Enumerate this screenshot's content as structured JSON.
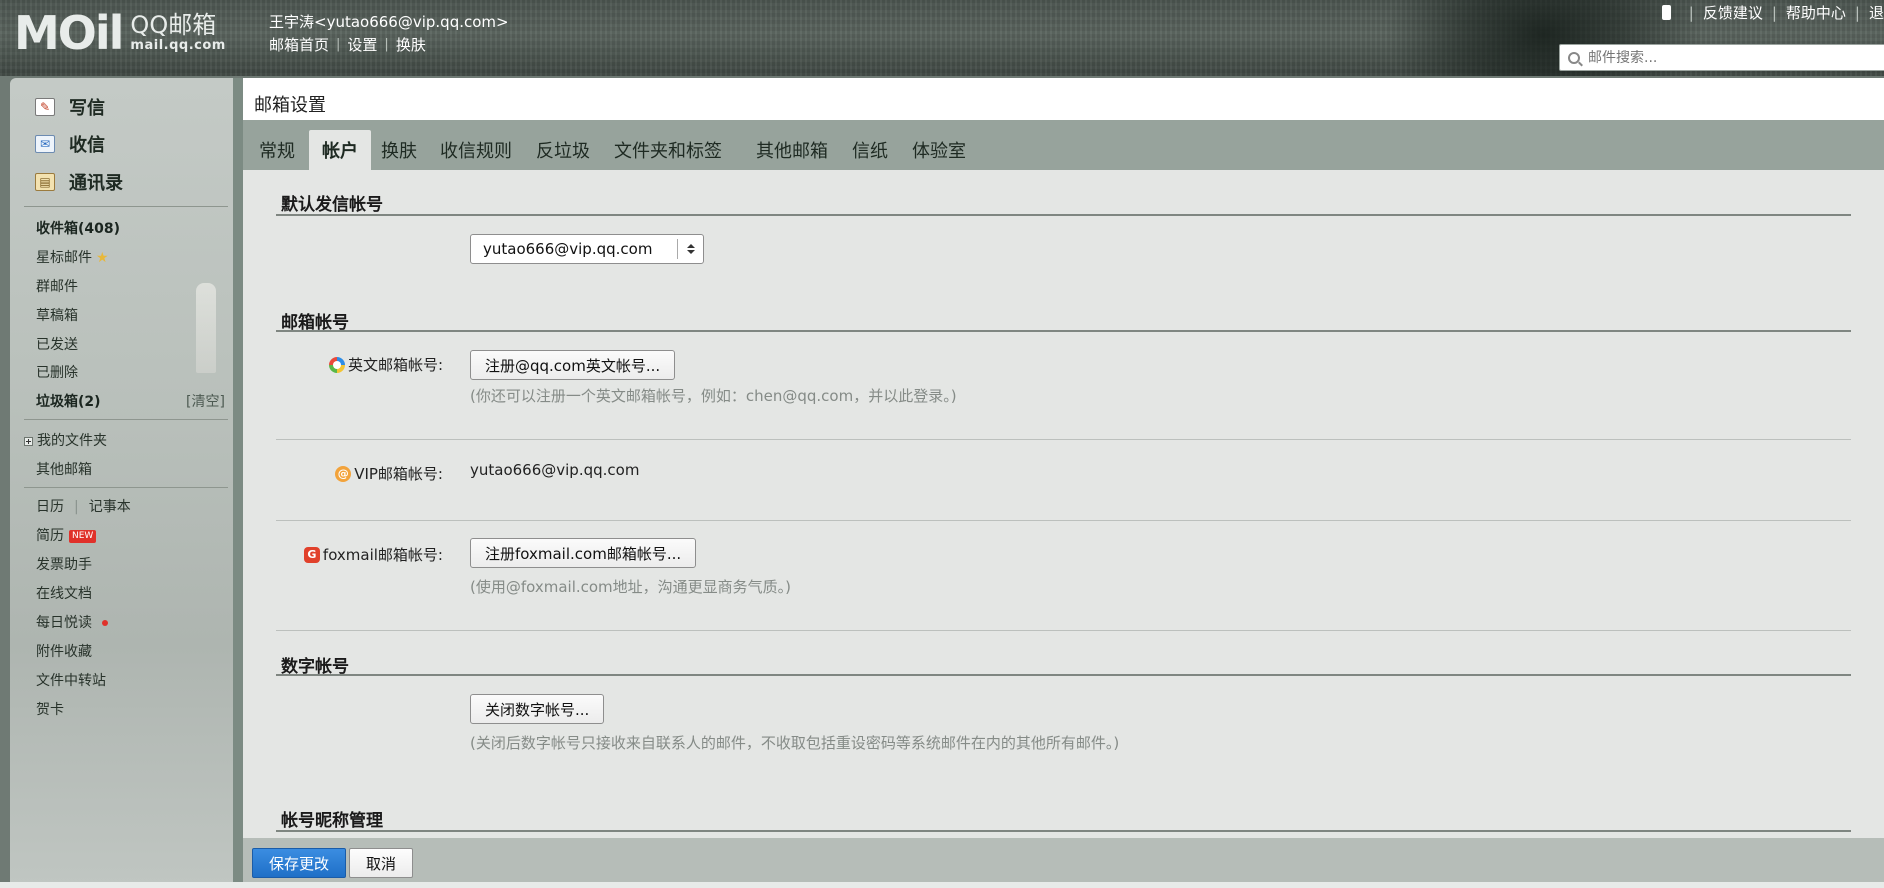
{
  "header": {
    "logo_mark": "MOil",
    "logo_title": "QQ邮箱",
    "logo_sub": "mail.qq.com",
    "user": "王宇涛<yutao666@vip.qq.com>",
    "links": [
      "邮箱首页",
      "设置",
      "换肤"
    ],
    "top_links": [
      "反馈建议",
      "帮助中心",
      "退"
    ],
    "search_placeholder": "邮件搜索..."
  },
  "sidebar": {
    "compose": "写信",
    "receive": "收信",
    "contacts": "通讯录",
    "folders": [
      {
        "label": "收件箱(408)"
      },
      {
        "label": "星标邮件"
      },
      {
        "label": "群邮件"
      },
      {
        "label": "草稿箱"
      },
      {
        "label": "已发送"
      },
      {
        "label": "已删除"
      },
      {
        "label": "垃圾箱(2)"
      }
    ],
    "clear": "[清空]",
    "my_folders": "我的文件夹",
    "other_mail": "其他邮箱",
    "calendar": "日历",
    "notes": "记事本",
    "resume": "简历",
    "new_badge": "NEW",
    "apps": [
      "发票助手",
      "在线文档",
      "每日悦读",
      "附件收藏",
      "文件中转站",
      "贺卡"
    ]
  },
  "main": {
    "title": "邮箱设置",
    "tabs": [
      "常规",
      "帐户",
      "换肤",
      "收信规则",
      "反垃圾",
      "文件夹和标签",
      "其他邮箱",
      "信纸",
      "体验室"
    ],
    "active_tab": "帐户",
    "sections": {
      "default_sender": {
        "title": "默认发信帐号",
        "selected": "yutao666@vip.qq.com"
      },
      "mail_accounts": {
        "title": "邮箱帐号",
        "english_label": "英文邮箱帐号:",
        "english_button": "注册@qq.com英文帐号...",
        "english_hint": "(你还可以注册一个英文邮箱帐号，例如：chen@qq.com，并以此登录。)",
        "vip_label": "VIP邮箱帐号:",
        "vip_value": "yutao666@vip.qq.com",
        "foxmail_label": "foxmail邮箱帐号:",
        "foxmail_button": "注册foxmail.com邮箱帐号...",
        "foxmail_hint": "(使用@foxmail.com地址，沟通更显商务气质。)"
      },
      "digital": {
        "title": "数字帐号",
        "button": "关闭数字帐号...",
        "hint": "(关闭后数字帐号只接收来自联系人的邮件，不收取包括重设密码等系统邮件在内的其他所有邮件。)"
      },
      "nickname": {
        "title": "帐号昵称管理"
      }
    },
    "save": "保存更改",
    "cancel": "取消"
  }
}
